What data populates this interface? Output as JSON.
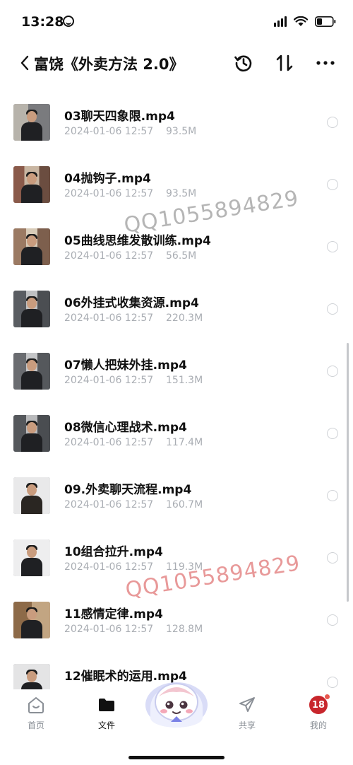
{
  "status_bar": {
    "time": "13:28"
  },
  "nav": {
    "title": "富饶《外卖方法 2.0》",
    "icons": [
      "back-chevron-icon",
      "history-clock-icon",
      "sort-arrows-icon",
      "more-dots-icon"
    ]
  },
  "files": [
    {
      "name": "03聊天四象限.mp4",
      "date": "2024-01-06 12:57",
      "size": "93.5M"
    },
    {
      "name": "04抛钩子.mp4",
      "date": "2024-01-06 12:57",
      "size": "93.5M"
    },
    {
      "name": "05曲线思维发散训练.mp4",
      "date": "2024-01-06 12:57",
      "size": "56.5M"
    },
    {
      "name": "06外挂式收集资源.mp4",
      "date": "2024-01-06 12:57",
      "size": "220.3M"
    },
    {
      "name": "07懒人把妹外挂.mp4",
      "date": "2024-01-06 12:57",
      "size": "151.3M"
    },
    {
      "name": "08微信心理战术.mp4",
      "date": "2024-01-06 12:57",
      "size": "117.4M"
    },
    {
      "name": "09.外卖聊天流程.mp4",
      "date": "2024-01-06 12:57",
      "size": "160.7M"
    },
    {
      "name": "10组合拉升.mp4",
      "date": "2024-01-06 12:57",
      "size": "119.3M"
    },
    {
      "name": "11感情定律.mp4",
      "date": "2024-01-06 12:57",
      "size": "128.8M"
    },
    {
      "name": "12催眠术的运用.mp4",
      "date": "",
      "size": ""
    }
  ],
  "watermarks": [
    "QQ1055894829",
    "QQ1055894829"
  ],
  "tab_bar": {
    "tabs": [
      {
        "label": "首页",
        "icon": "home-icon"
      },
      {
        "label": "文件",
        "icon": "folder-icon",
        "active": true
      },
      {
        "label": "共享",
        "icon": "share-send-icon"
      },
      {
        "label": "我的",
        "icon": "profile-avatar-icon",
        "avatar_text": "18"
      }
    ]
  }
}
